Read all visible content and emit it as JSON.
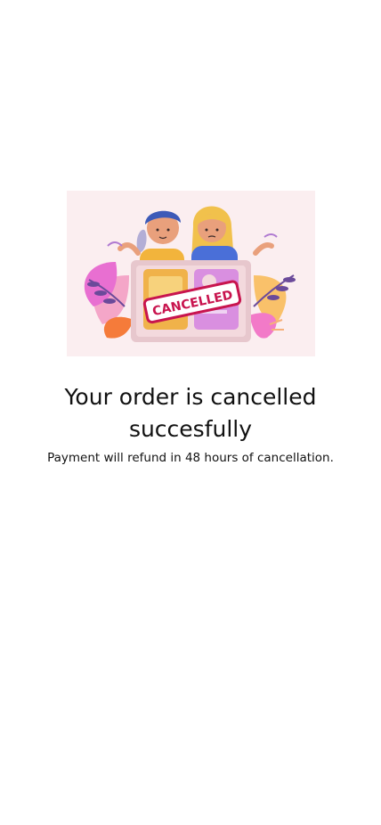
{
  "illustration": {
    "stamp_text": "CANCELLED",
    "colors": {
      "background": "#fbeef0",
      "stamp": "#c8144e",
      "card_left": "#f0b24a",
      "card_right": "#d98fe0",
      "screen": "#f3d9dd"
    }
  },
  "message": {
    "title": "Your order is cancelled succesfully",
    "subtitle": "Payment will refund in 48 hours of cancellation."
  }
}
